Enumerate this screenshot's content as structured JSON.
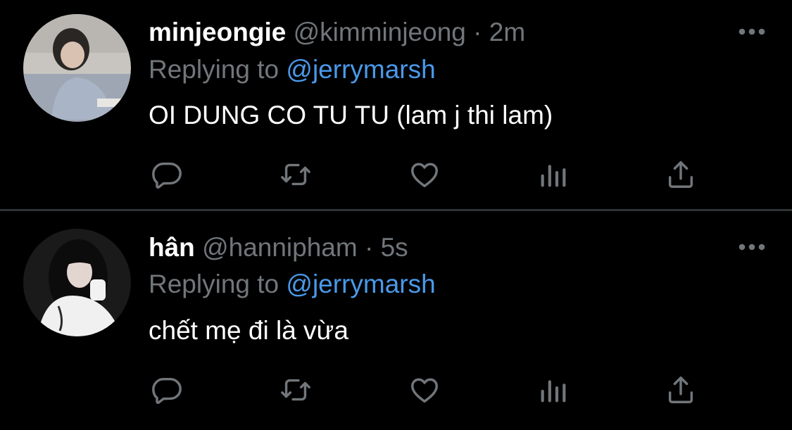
{
  "colors": {
    "background": "#000000",
    "divider": "#2f3336",
    "secondary_text": "#71767b",
    "primary_text": "#ffffff",
    "link": "#4a99e9",
    "icon": "#71767b"
  },
  "tweets": [
    {
      "display_name": "minjeongie",
      "handle": "@kimminjeong",
      "separator": "·",
      "time": "2m",
      "replying_prefix": "Replying to",
      "replying_to": "@jerrymarsh",
      "text": "OI DUNG CO TU TU (lam j thi lam)",
      "actions": [
        "reply-icon",
        "retweet-icon",
        "like-icon",
        "views-icon",
        "share-icon"
      ],
      "more_icon": "more-icon"
    },
    {
      "display_name": "hân",
      "handle": "@hannipham",
      "separator": "·",
      "time": "5s",
      "replying_prefix": "Replying to",
      "replying_to": "@jerrymarsh",
      "text": "chết mẹ đi là vừa",
      "actions": [
        "reply-icon",
        "retweet-icon",
        "like-icon",
        "views-icon",
        "share-icon"
      ],
      "more_icon": "more-icon"
    }
  ]
}
